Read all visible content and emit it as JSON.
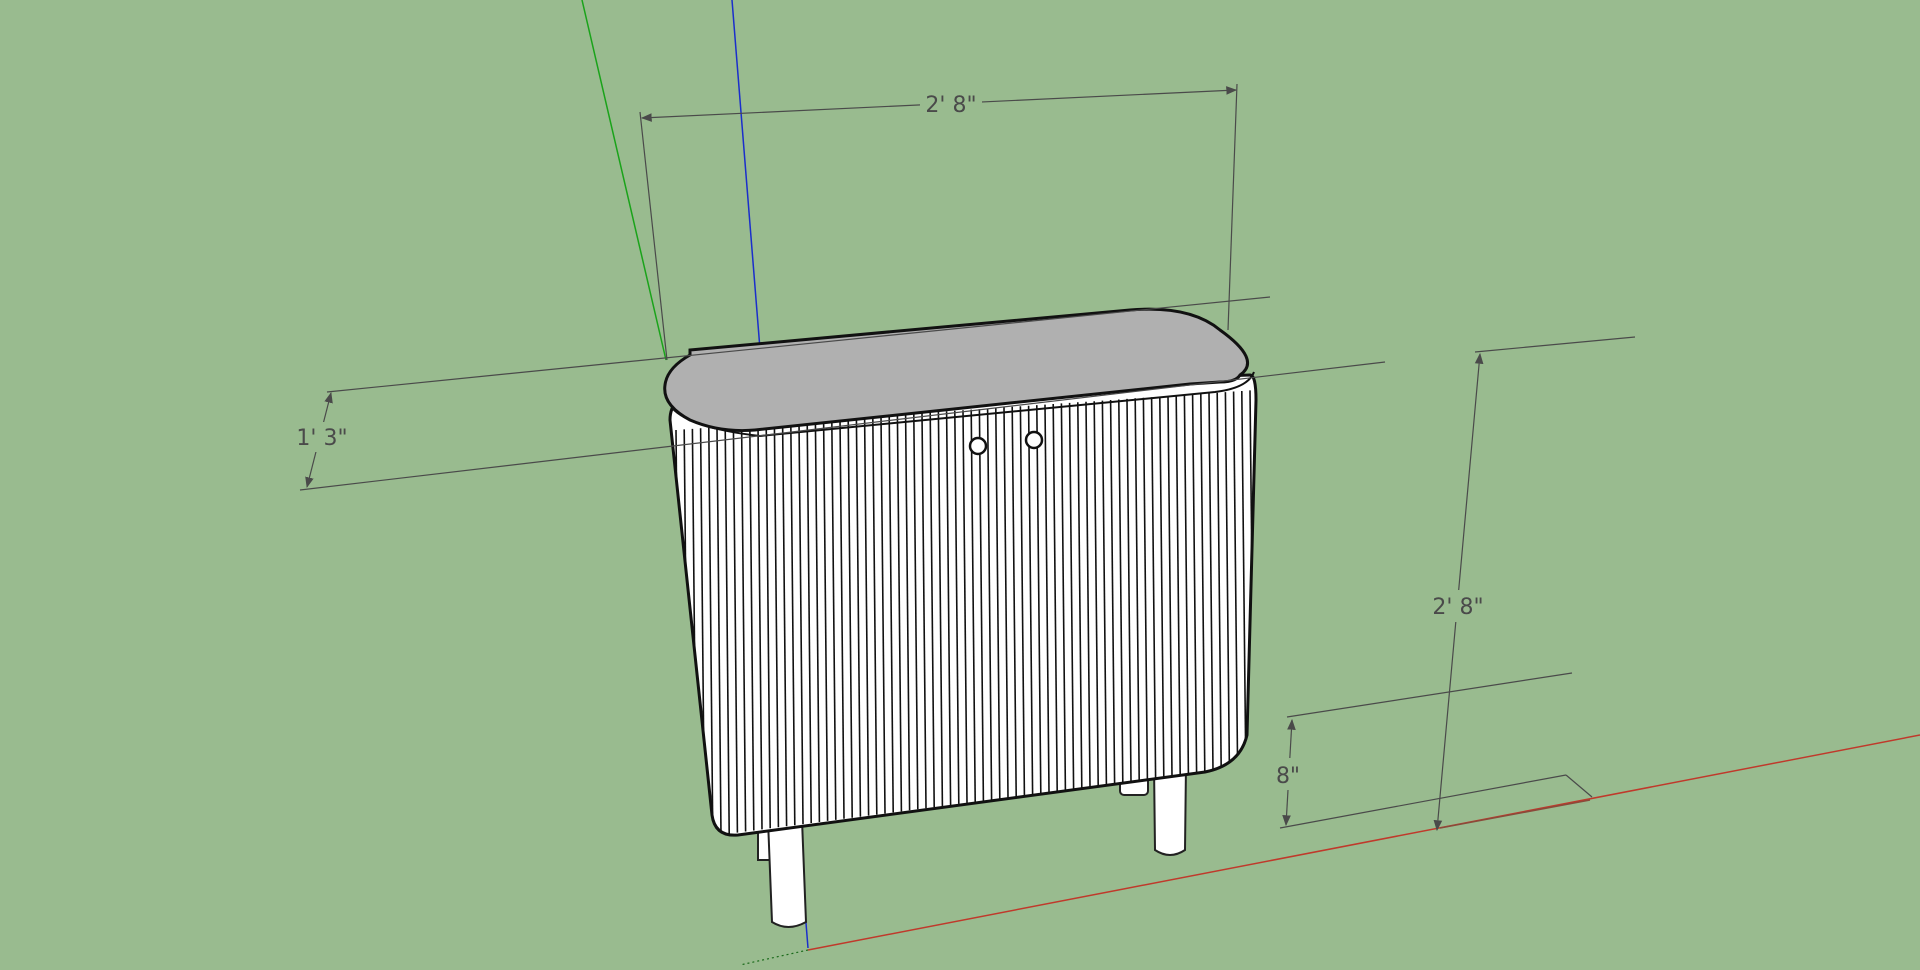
{
  "viewport": {
    "background": "#99bb8f",
    "axes": {
      "red_axis_color": "#c0392b",
      "green_axis_color": "#1aa31a",
      "blue_axis_color": "#1a2ecc"
    }
  },
  "model": {
    "top_color": "#b0b0b0",
    "body_color": "#ffffff",
    "fluting_color": "#111111",
    "handles": 2,
    "legs": 4
  },
  "dimensions": {
    "width_label": "2' 8\"",
    "depth_label": "1' 3\"",
    "height_label": "2' 8\"",
    "leg_height_label": "8\""
  }
}
